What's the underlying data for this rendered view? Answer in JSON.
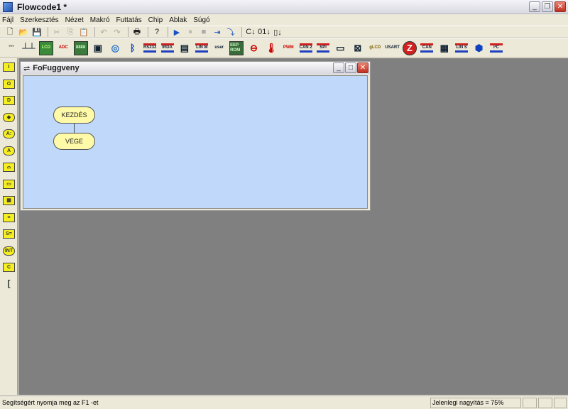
{
  "window": {
    "title": "Flowcode1 *",
    "min": "_",
    "max": "❐",
    "close": "✕"
  },
  "menu": [
    "Fájl",
    "Szerkesztés",
    "Nézet",
    "Makró",
    "Futtatás",
    "Chip",
    "Ablak",
    "Súgó"
  ],
  "toolbar1": [
    {
      "name": "new-icon",
      "g": "🗋"
    },
    {
      "name": "open-icon",
      "g": "📂"
    },
    {
      "name": "save-icon",
      "g": "💾"
    },
    "sep",
    {
      "name": "cut-icon",
      "g": "✂",
      "dis": true
    },
    {
      "name": "copy-icon",
      "g": "⎘",
      "dis": true
    },
    {
      "name": "paste-icon",
      "g": "📋",
      "dis": true
    },
    "sep",
    {
      "name": "undo-icon",
      "g": "↶",
      "dis": true
    },
    {
      "name": "redo-icon",
      "g": "↷",
      "dis": true
    },
    "sep",
    {
      "name": "print-icon",
      "g": "🖶"
    },
    "sep",
    {
      "name": "help-icon",
      "g": "?"
    },
    "sep",
    {
      "name": "run-icon",
      "g": "▶",
      "blue": true
    },
    {
      "name": "pause-icon",
      "g": "⏸",
      "dis": true
    },
    {
      "name": "stop-icon",
      "g": "■",
      "dis": true
    },
    {
      "name": "step-into-icon",
      "g": "⇥",
      "blue": true
    },
    {
      "name": "step-over-icon",
      "g": "⤵",
      "blue": true
    },
    "sep",
    {
      "name": "compile-c-icon",
      "g": "C↓"
    },
    {
      "name": "compile-hex-icon",
      "g": "01↓"
    },
    {
      "name": "compile-chip-icon",
      "g": "▯↓"
    }
  ],
  "toolbar2": [
    {
      "name": "leds-icon",
      "t": "°°°"
    },
    {
      "name": "switches-icon",
      "t": "┴┴"
    },
    {
      "name": "lcd-icon",
      "t": "LCD",
      "bg": "#3a8a3a",
      "c": "#bfff80"
    },
    {
      "name": "adc-icon",
      "t": "ADC",
      "c": "#c00"
    },
    {
      "name": "seven-seg-icon",
      "t": "8888",
      "bg": "#3a7a3a",
      "c": "#cfc"
    },
    {
      "name": "keypad-icon",
      "t": "▣"
    },
    {
      "name": "web-icon",
      "t": "◎",
      "c": "#2a70c8"
    },
    {
      "name": "bluetooth-icon",
      "t": "ᛒ",
      "c": "#1040c0"
    },
    {
      "name": "rs232-icon",
      "t": "RS232",
      "arrows": true
    },
    {
      "name": "irda-icon",
      "t": "IRDA",
      "arrows": true
    },
    {
      "name": "file-icon",
      "t": "▤"
    },
    {
      "name": "lin-master-icon",
      "t": "LIN M",
      "arrows": true
    },
    {
      "name": "user-component-icon",
      "t": "user"
    },
    {
      "name": "eeprom-icon",
      "t": "EEP ROM",
      "bg": "#3a6a3a",
      "c": "#cfc"
    },
    {
      "name": "alarm-icon",
      "t": "⊖",
      "c": "#c00"
    },
    {
      "name": "thermometer-icon",
      "t": "🌡",
      "c": "#c00"
    },
    {
      "name": "pwm-icon",
      "t": "PWM",
      "c": "#c00"
    },
    {
      "name": "can2-icon",
      "t": "CAN 2",
      "arrows": true
    },
    {
      "name": "spi-icon",
      "t": "SPI",
      "arrows": true
    },
    {
      "name": "tftp-icon",
      "t": "▭"
    },
    {
      "name": "touch-icon",
      "t": "⊠"
    },
    {
      "name": "glcd-icon",
      "t": "gLCD",
      "c": "#806000"
    },
    {
      "name": "usart-icon",
      "t": "USART"
    },
    {
      "name": "zigbee-icon",
      "t": "Z",
      "c": "#fff",
      "bg": "#d02020"
    },
    {
      "name": "can-icon",
      "t": "CAN",
      "arrows": true
    },
    {
      "name": "keypad-matrix-icon",
      "t": "▦"
    },
    {
      "name": "lin-slave-icon",
      "t": "LIN S",
      "arrows": true
    },
    {
      "name": "robot-icon",
      "t": "⬢",
      "c": "#1040c0"
    },
    {
      "name": "i2c-icon",
      "t": "I²C",
      "arrows": true
    }
  ],
  "palette": [
    "I",
    "O",
    "D",
    "◆",
    "A:",
    "A",
    "⌓",
    "▭",
    "▦",
    "=",
    "S=",
    "INT",
    "C",
    "["
  ],
  "child": {
    "title": "FoFuggveny",
    "start": "KEZDÉS",
    "end": "VÉGE"
  },
  "status": {
    "help": "Segítségért nyomja meg az F1 -et",
    "zoom": "Jelenlegi nagyítás = 75%"
  }
}
